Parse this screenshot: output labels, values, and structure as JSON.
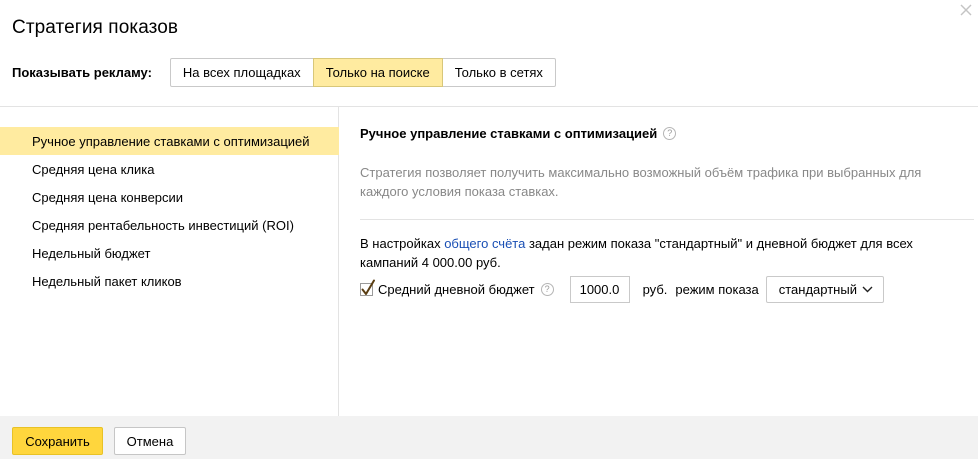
{
  "dialog": {
    "title": "Стратегия показов"
  },
  "show_ads": {
    "label": "Показывать рекламу:",
    "options": [
      "На всех площадках",
      "Только на поиске",
      "Только в сетях"
    ],
    "selected": "Только на поиске"
  },
  "sidebar": {
    "items": [
      "Ручное управление ставками с оптимизацией",
      "Средняя цена клика",
      "Средняя цена конверсии",
      "Средняя рентабельность инвестиций (ROI)",
      "Недельный бюджет",
      "Недельный пакет кликов"
    ],
    "selected": "Ручное управление ставками с оптимизацией"
  },
  "content": {
    "title": "Ручное управление ставками с оптимизацией",
    "help": "?",
    "description": "Стратегия позволяет получить максимально возможный объём трафика при выбранных для каждого условия показа ставках.",
    "info_prefix": "В настройках ",
    "info_link": "общего счёта",
    "info_suffix": " задан режим показа \"стандартный\" и дневной бюджет для всех кампаний 4 000.00 руб.",
    "budget_checkbox_label": "Средний дневной бюджет",
    "budget_checked": true,
    "budget_value": "1000.0",
    "currency": "руб.",
    "mode_label": "режим показа",
    "mode_value": "стандартный"
  },
  "footer": {
    "save_label": "Сохранить",
    "cancel_label": "Отмена"
  },
  "colors": {
    "accent_yellow": "#ffeba0",
    "save_yellow": "#ffd63d",
    "link_blue": "#1a4fb4"
  },
  "icons": {
    "close": "close-icon",
    "help": "help-icon",
    "check": "check-icon",
    "chevron": "chevron-down-icon"
  }
}
